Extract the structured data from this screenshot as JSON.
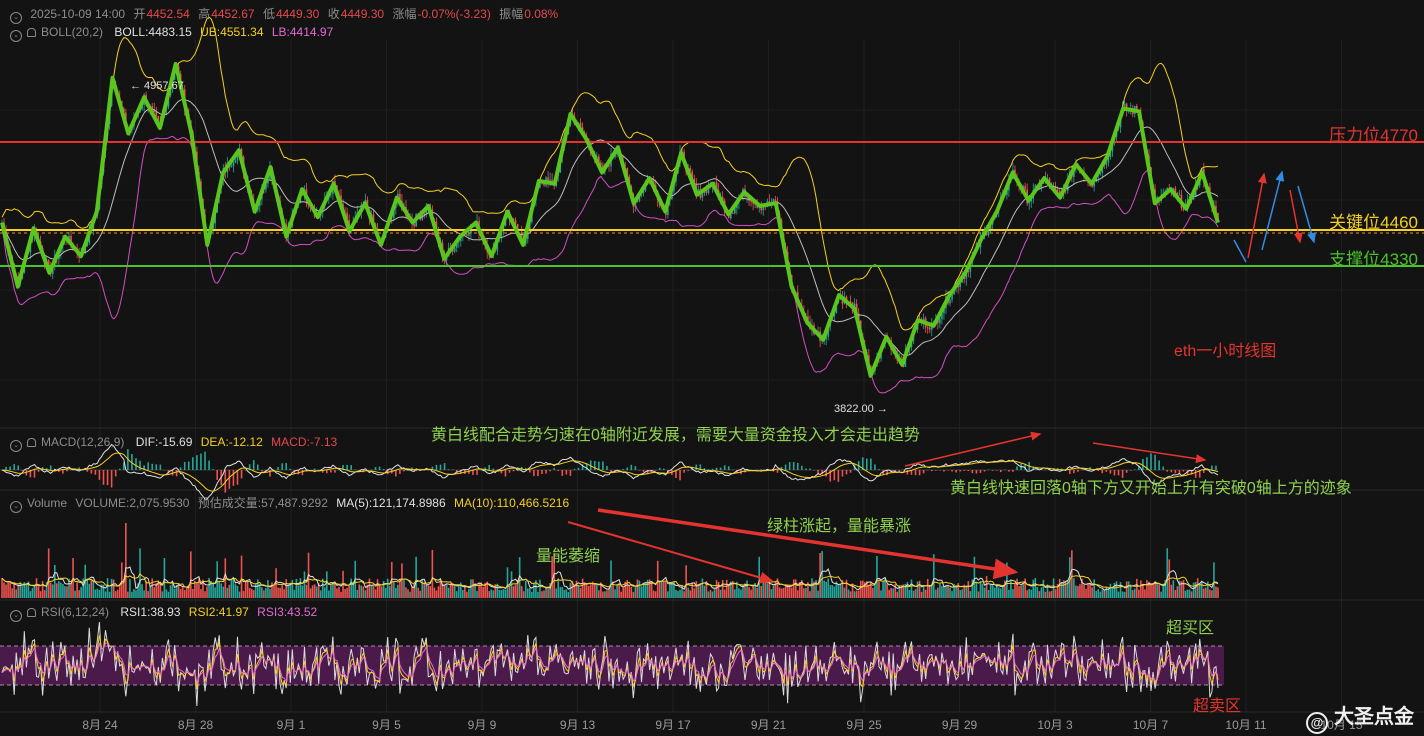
{
  "header": {
    "date": "2025-10-09 14:00",
    "open_label": "开",
    "open": "4452.54",
    "high_label": "高",
    "high": "4452.67",
    "low_label": "低",
    "low": "4449.30",
    "close_label": "收",
    "close": "4449.30",
    "change_label": "涨幅",
    "change": "-0.07%(-3.23)",
    "amplitude_label": "振幅",
    "amplitude": "0.08%"
  },
  "boll": {
    "name": "BOLL(20,2)",
    "boll": "BOLL:4483.15",
    "ub": "UB:4551.34",
    "lb": "LB:4414.97"
  },
  "macd": {
    "name": "MACD(12,26,9)",
    "dif": "DIF:-15.69",
    "dea": "DEA:-12.12",
    "macd": "MACD:-7.13"
  },
  "volume": {
    "name": "Volume",
    "volume": "VOLUME:2,075.9530",
    "estimate": "预估成交量:57,487.9292",
    "ma5": "MA(5):121,174.8986",
    "ma10": "MA(10):110,466.5216"
  },
  "rsi": {
    "name": "RSI(6,12,24)",
    "rsi1": "RSI1:38.93",
    "rsi2": "RSI2:41.97",
    "rsi3": "RSI3:43.52"
  },
  "levels": {
    "resistance": {
      "label": "压力位4770",
      "value": 4770,
      "color": "#e5342f"
    },
    "key": {
      "label": "关键位4460",
      "value": 4460,
      "color": "#f5d020"
    },
    "support": {
      "label": "支撑位4330",
      "value": 4330,
      "color": "#4cc22a"
    }
  },
  "annotations": {
    "chart_title": "eth一小时线图",
    "macd_note_1": "黄白线配合走势匀速在0轴附近发展，需要大量资金投入才会走出趋势",
    "macd_note_2": "黄白线快速回落0轴下方又开始上升有突破0轴上方的迹象",
    "volume_note_1": "量能萎缩",
    "volume_note_2": "绿柱涨起，量能暴涨",
    "overbought": "超买区",
    "oversold": "超卖区"
  },
  "markers": {
    "high": "← 4957.67",
    "low": "3822.00 →"
  },
  "watermark": "大圣点金",
  "colors": {
    "up": "#26a69a",
    "down": "#ef5350",
    "trend": "#5ac51d",
    "boll_upper": "#f5d020",
    "boll_lower": "#d14fc4",
    "boll_mid": "#bdbdbd",
    "rsi_band": "#4a1b4a"
  },
  "chart_data": {
    "type": "line",
    "title": "eth一小时线图",
    "x_ticks": [
      "8月 24",
      "8月 28",
      "9月 1",
      "9月 5",
      "9月 9",
      "9月 13",
      "9月 17",
      "9月 21",
      "9月 25",
      "9月 29",
      "10月 3",
      "10月 7",
      "10月 11",
      "10月 15"
    ],
    "ylim": [
      3700,
      5000
    ],
    "trend_price": [
      4380,
      4150,
      4360,
      4200,
      4330,
      4260,
      4420,
      4900,
      4700,
      4830,
      4720,
      4950,
      4700,
      4300,
      4560,
      4640,
      4420,
      4580,
      4330,
      4500,
      4400,
      4520,
      4350,
      4450,
      4300,
      4470,
      4380,
      4440,
      4250,
      4330,
      4380,
      4260,
      4420,
      4300,
      4530,
      4520,
      4770,
      4680,
      4560,
      4650,
      4450,
      4540,
      4420,
      4630,
      4480,
      4520,
      4410,
      4490,
      4440,
      4450,
      4150,
      4020,
      3960,
      4120,
      4070,
      3830,
      3970,
      3870,
      4030,
      4010,
      4120,
      4200,
      4320,
      4420,
      4560,
      4460,
      4540,
      4470,
      4590,
      4520,
      4620,
      4790,
      4780,
      4450,
      4500,
      4430,
      4560,
      4380
    ],
    "high_marker": 4957.67,
    "low_marker": 3822.0,
    "levels": [
      4770,
      4460,
      4330
    ]
  }
}
